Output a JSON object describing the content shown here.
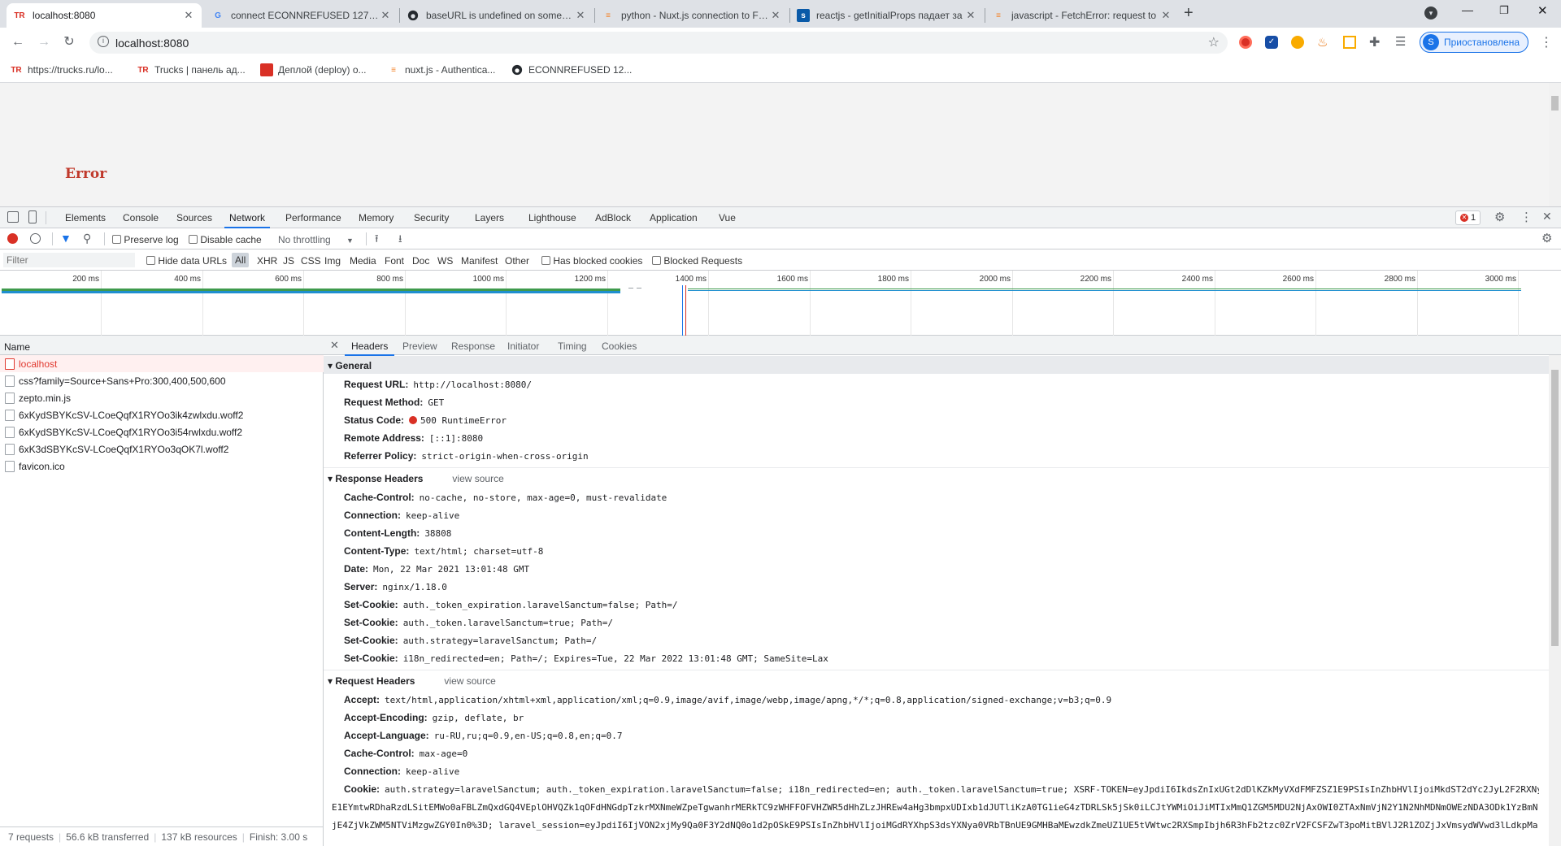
{
  "browser": {
    "tabs": [
      {
        "title": "localhost:8080",
        "favicon": "TR",
        "active": true
      },
      {
        "title": "connect ECONNREFUSED 127.0.0.1:8080",
        "favicon": "G"
      },
      {
        "title": "baseURL is undefined on some pages",
        "favicon": "gh"
      },
      {
        "title": "python - Nuxt.js connection to Flask",
        "favicon": "so"
      },
      {
        "title": "reactjs - getInitialProps падает за",
        "favicon": "so"
      },
      {
        "title": "javascript - FetchError: request to",
        "favicon": "so"
      }
    ],
    "new_tab": "+",
    "address": "localhost:8080",
    "profile_label": "Приостановлена",
    "profile_initial": "S",
    "bookmarks": [
      {
        "label": "https://trucks.ru/lo...",
        "icon": "TR"
      },
      {
        "label": "Trucks | панель ад...",
        "icon": "TR"
      },
      {
        "label": "Деплой (deploy) о...",
        "icon": "folder"
      },
      {
        "label": "nuxt.js - Authentica...",
        "icon": "so"
      },
      {
        "label": "ECONNREFUSED 12...",
        "icon": "gh"
      }
    ]
  },
  "page": {
    "error_text": "Error"
  },
  "devtools": {
    "tabs": [
      "Elements",
      "Console",
      "Sources",
      "Network",
      "Performance",
      "Memory",
      "Security",
      "Layers",
      "Lighthouse",
      "AdBlock",
      "Application",
      "Vue"
    ],
    "active_tab": "Network",
    "error_count": "1",
    "toolbar": {
      "preserve_log": "Preserve log",
      "disable_cache": "Disable cache",
      "throttling": "No throttling"
    },
    "filter": {
      "placeholder": "Filter",
      "hide_data_urls": "Hide data URLs",
      "types": [
        "All",
        "XHR",
        "JS",
        "CSS",
        "Img",
        "Media",
        "Font",
        "Doc",
        "WS",
        "Manifest",
        "Other"
      ],
      "has_blocked_cookies": "Has blocked cookies",
      "blocked_requests": "Blocked Requests"
    },
    "timeline_ticks": [
      "200 ms",
      "400 ms",
      "600 ms",
      "800 ms",
      "1000 ms",
      "1200 ms",
      "1400 ms",
      "1600 ms",
      "1800 ms",
      "2000 ms",
      "2200 ms",
      "2400 ms",
      "2600 ms",
      "2800 ms",
      "3000 ms"
    ],
    "name_header": "Name",
    "requests": [
      {
        "name": "localhost",
        "error": true
      },
      {
        "name": "css?family=Source+Sans+Pro:300,400,500,600"
      },
      {
        "name": "zepto.min.js"
      },
      {
        "name": "6xKydSBYKcSV-LCoeQqfX1RYOo3ik4zwlxdu.woff2"
      },
      {
        "name": "6xKydSBYKcSV-LCoeQqfX1RYOo3i54rwlxdu.woff2"
      },
      {
        "name": "6xK3dSBYKcSV-LCoeQqfX1RYOo3qOK7l.woff2"
      },
      {
        "name": "favicon.ico"
      }
    ],
    "status": {
      "requests": "7 requests",
      "transferred": "56.6 kB transferred",
      "resources": "137 kB resources",
      "finish": "Finish: 3.00 s"
    },
    "detail_tabs": [
      "Headers",
      "Preview",
      "Response",
      "Initiator",
      "Timing",
      "Cookies"
    ],
    "general": {
      "title": "General",
      "rows": [
        {
          "k": "Request URL:",
          "v": "http://localhost:8080/"
        },
        {
          "k": "Request Method:",
          "v": "GET"
        },
        {
          "k": "Status Code:",
          "v": "500 RuntimeError"
        },
        {
          "k": "Remote Address:",
          "v": "[::1]:8080"
        },
        {
          "k": "Referrer Policy:",
          "v": "strict-origin-when-cross-origin"
        }
      ]
    },
    "response_headers": {
      "title": "Response Headers",
      "view_source": "view source",
      "rows": [
        {
          "k": "Cache-Control:",
          "v": "no-cache, no-store, max-age=0, must-revalidate"
        },
        {
          "k": "Connection:",
          "v": "keep-alive"
        },
        {
          "k": "Content-Length:",
          "v": "38808"
        },
        {
          "k": "Content-Type:",
          "v": "text/html; charset=utf-8"
        },
        {
          "k": "Date:",
          "v": "Mon, 22 Mar 2021 13:01:48 GMT"
        },
        {
          "k": "Server:",
          "v": "nginx/1.18.0"
        },
        {
          "k": "Set-Cookie:",
          "v": "auth._token_expiration.laravelSanctum=false; Path=/"
        },
        {
          "k": "Set-Cookie:",
          "v": "auth._token.laravelSanctum=true; Path=/"
        },
        {
          "k": "Set-Cookie:",
          "v": "auth.strategy=laravelSanctum; Path=/"
        },
        {
          "k": "Set-Cookie:",
          "v": "i18n_redirected=en; Path=/; Expires=Tue, 22 Mar 2022 13:01:48 GMT; SameSite=Lax"
        }
      ]
    },
    "request_headers": {
      "title": "Request Headers",
      "view_source": "view source",
      "rows": [
        {
          "k": "Accept:",
          "v": "text/html,application/xhtml+xml,application/xml;q=0.9,image/avif,image/webp,image/apng,*/*;q=0.8,application/signed-exchange;v=b3;q=0.9"
        },
        {
          "k": "Accept-Encoding:",
          "v": "gzip, deflate, br"
        },
        {
          "k": "Accept-Language:",
          "v": "ru-RU,ru;q=0.9,en-US;q=0.8,en;q=0.7"
        },
        {
          "k": "Cache-Control:",
          "v": "max-age=0"
        },
        {
          "k": "Connection:",
          "v": "keep-alive"
        },
        {
          "k": "Cookie:",
          "v": "auth.strategy=laravelSanctum; auth._token_expiration.laravelSanctum=false; i18n_redirected=en; auth._token.laravelSanctum=true; XSRF-TOKEN=eyJpdiI6IkdsZnIxUGt2dDlKZkMyVXdFMFZSZ1E9PSIsInZhbHVlIjoiMkdST2dYc2JyL2F2RXNyM"
        },
        {
          "k": "",
          "v": "E1EYmtwRDhaRzdLSitEMWo0aFBLZmQxdGQ4VEplOHVQZk1qOFdHNGdpTzkrMXNmeWZpeTgwanhrMERkTC9zWHFFOFVHZWR5dHhZLzJHREw4aHg3bmpxUDIxb1dJUTliKzA0TG1ieG4zTDRLSk5jSk0iLCJtYWMiOiJiMTIxMmQ1ZGM5MDU2NjAxOWI0ZTAxNmVjN2Y1N2NhMDNmOWEzNDA3ODk1YzBmN"
        },
        {
          "k": "",
          "v": "jE4ZjVkZWM5NTViMzgwZGY0In0%3D; laravel_session=eyJpdiI6IjVON2xjMy9Qa0F3Y2dNQ0o1d2pOSkE9PSIsInZhbHVlIjoiMGdRYXhpS3dsYXNya0VRbTBnUE9GMHBaMEwzdkZmeUZ1UE5tVWtwc2RXSmpIbjh6R3hFb2tzc0ZrV2FCSFZwT3poMitBVlJ2R1ZOZjJxVmsydWVwd3lLdkpMa"
        }
      ]
    }
  }
}
